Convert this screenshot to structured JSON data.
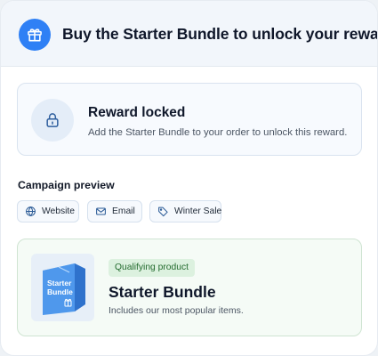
{
  "header": {
    "title": "Buy the Starter Bundle to unlock your reward",
    "icon": "gift-icon",
    "accent_color": "#2f80f5"
  },
  "reward": {
    "icon": "lock-icon",
    "title": "Reward locked",
    "description": "Add the Starter Bundle to your order to unlock this reward."
  },
  "campaign_preview": {
    "label": "Campaign preview",
    "chips": [
      {
        "label": "Website",
        "icon": "globe-icon"
      },
      {
        "label": "Email",
        "icon": "mail-icon"
      },
      {
        "label": "Winter Sale",
        "icon": "tag-icon"
      }
    ]
  },
  "product": {
    "badge": "Qualifying product",
    "name": "Starter Bundle",
    "description": "Includes our most popular items.",
    "box_label_line1": "Starter",
    "box_label_line2": "Bundle",
    "badge_color": "#236b2e"
  }
}
